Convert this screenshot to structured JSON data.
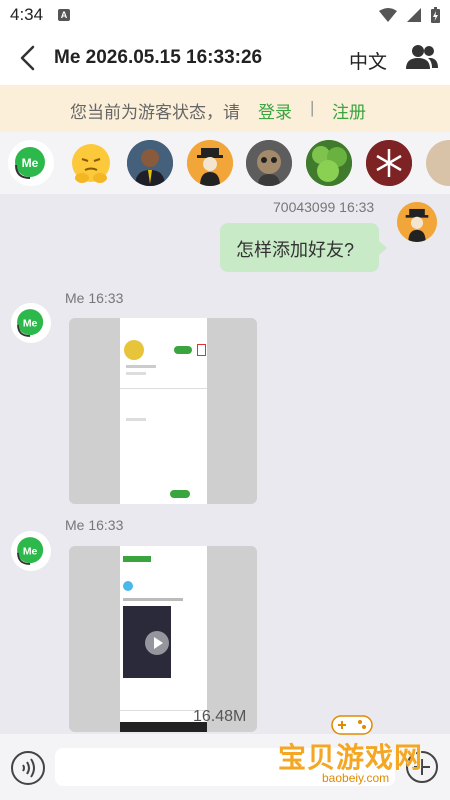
{
  "status_bar": {
    "time": "4:34",
    "notification_icon": "A"
  },
  "header": {
    "title": "Me 2026.05.15 16:33:26",
    "language": "中文"
  },
  "guest_notice": {
    "message": "您当前为游客状态，请",
    "login": "登录",
    "separator": "|",
    "register": "注册"
  },
  "contacts": [
    {
      "name": "me-logo"
    },
    {
      "name": "emoji-face"
    },
    {
      "name": "man-photo"
    },
    {
      "name": "cartoon-figure"
    },
    {
      "name": "monkey-art"
    },
    {
      "name": "green-plant"
    },
    {
      "name": "snowflake"
    },
    {
      "name": "partial-photo"
    }
  ],
  "messages": [
    {
      "sender": "70043099",
      "time": "16:33",
      "meta": "70043099 16:33",
      "text": "怎样添加好友?"
    },
    {
      "meta": "Me 16:33",
      "type": "image"
    },
    {
      "meta": "Me 16:33",
      "type": "video",
      "size": "16.48M"
    }
  ],
  "avatar_label": "Me",
  "input": {
    "placeholder": ""
  },
  "watermark": {
    "text": "宝贝游戏网",
    "url": "baobeiy.com"
  },
  "colors": {
    "accent_green": "#3aa43f",
    "bubble_green": "#c8eac6",
    "guest_bg": "#fcefd9"
  }
}
